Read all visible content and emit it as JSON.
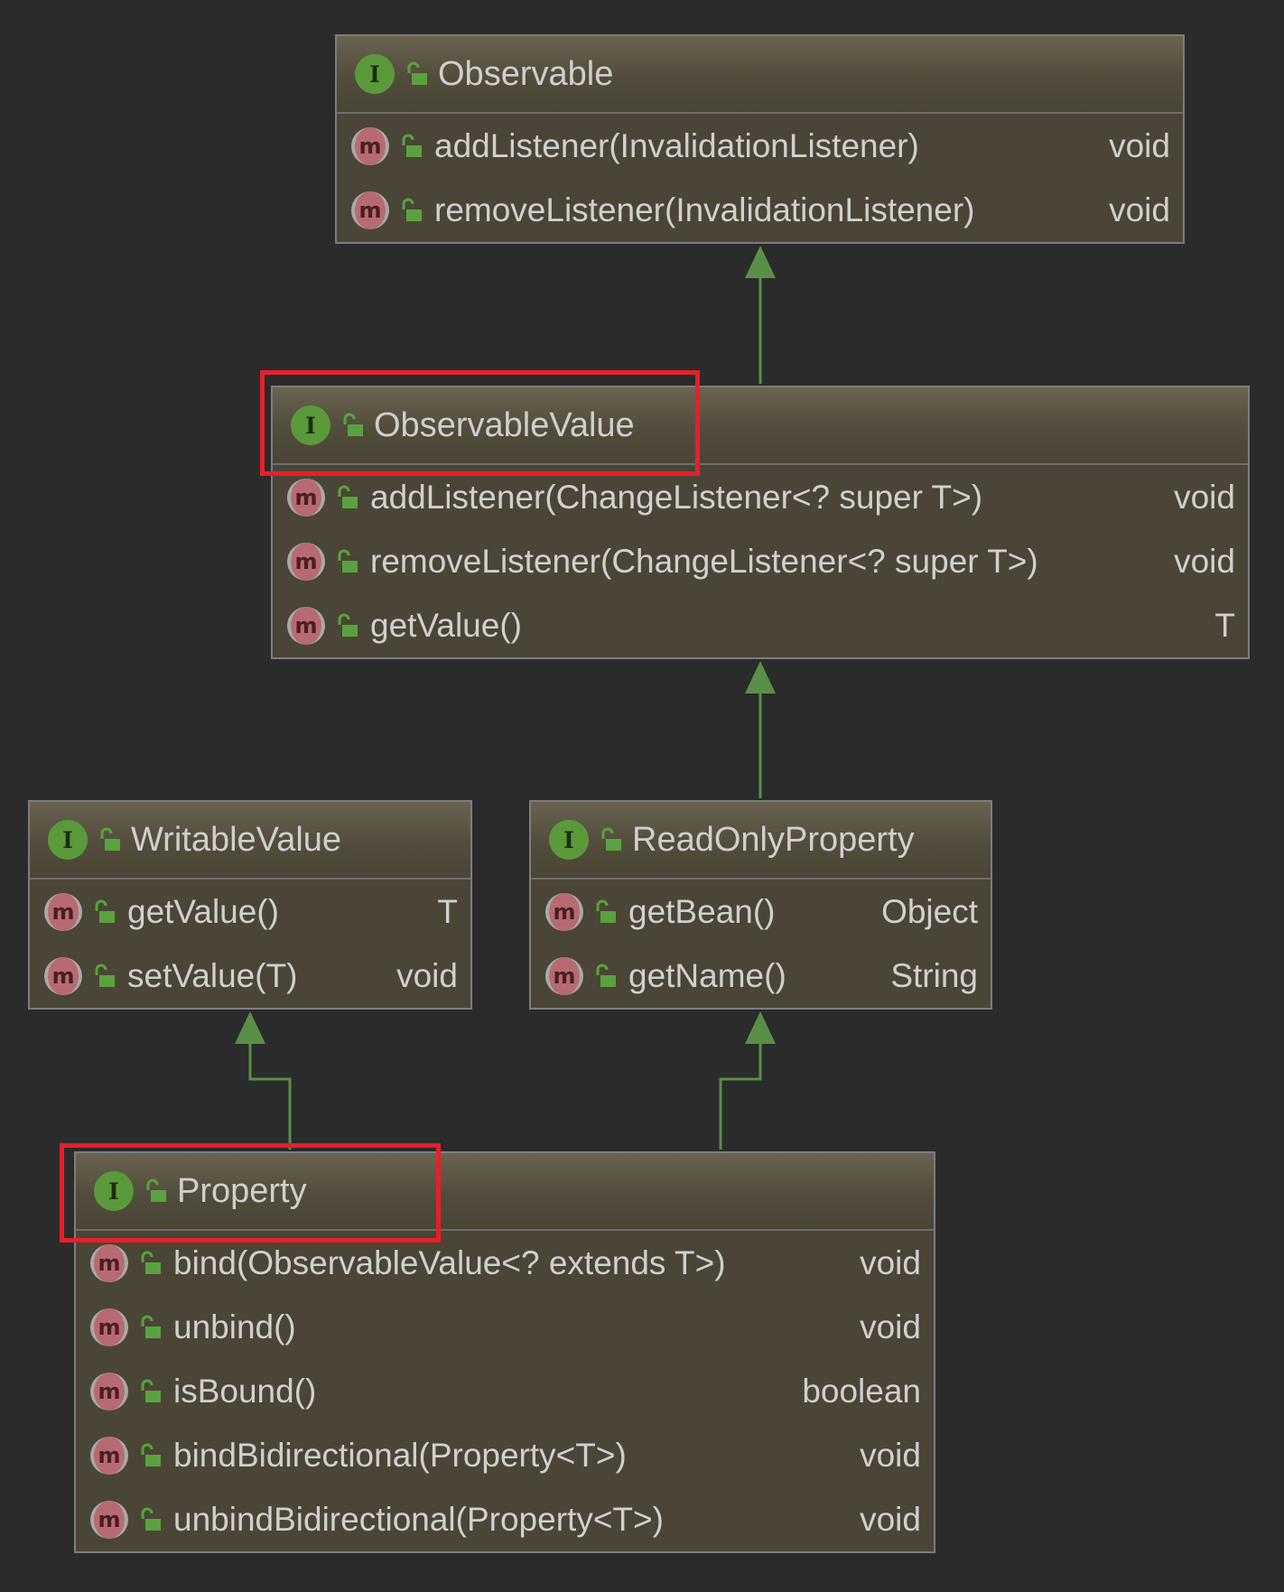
{
  "diagram": {
    "type": "uml-class-diagram",
    "colors": {
      "background": "#2b2b2b",
      "box_fill": "#4a4536",
      "arrow": "#5a8f48",
      "highlight": "#e5202a",
      "interface_icon": "#5a9a3a",
      "method_icon": "#b86a72"
    },
    "icons": {
      "interface": "interface-icon",
      "method": "method-icon",
      "visibility": "public-visibility-icon"
    },
    "interface_glyph": "I",
    "method_glyph": "m",
    "classes": {
      "observable": {
        "name": "Observable",
        "methods": [
          {
            "signature": "addListener(InvalidationListener)",
            "return_type": "void"
          },
          {
            "signature": "removeListener(InvalidationListener)",
            "return_type": "void"
          }
        ]
      },
      "observable_value": {
        "name": "ObservableValue",
        "highlighted": true,
        "methods": [
          {
            "signature": "addListener(ChangeListener<? super T>)",
            "return_type": "void"
          },
          {
            "signature": "removeListener(ChangeListener<? super T>)",
            "return_type": "void"
          },
          {
            "signature": "getValue()",
            "return_type": "T"
          }
        ]
      },
      "writable_value": {
        "name": "WritableValue",
        "methods": [
          {
            "signature": "getValue()",
            "return_type": "T"
          },
          {
            "signature": "setValue(T)",
            "return_type": "void"
          }
        ]
      },
      "read_only_property": {
        "name": "ReadOnlyProperty",
        "methods": [
          {
            "signature": "getBean()",
            "return_type": "Object"
          },
          {
            "signature": "getName()",
            "return_type": "String"
          }
        ]
      },
      "property": {
        "name": "Property",
        "highlighted": true,
        "methods": [
          {
            "signature": "bind(ObservableValue<? extends T>)",
            "return_type": "void"
          },
          {
            "signature": "unbind()",
            "return_type": "void"
          },
          {
            "signature": "isBound()",
            "return_type": "boolean"
          },
          {
            "signature": "bindBidirectional(Property<T>)",
            "return_type": "void"
          },
          {
            "signature": "unbindBidirectional(Property<T>)",
            "return_type": "void"
          }
        ]
      }
    },
    "inheritance": [
      {
        "from": "ObservableValue",
        "to": "Observable"
      },
      {
        "from": "ReadOnlyProperty",
        "to": "ObservableValue"
      },
      {
        "from": "Property",
        "to": "WritableValue"
      },
      {
        "from": "Property",
        "to": "ReadOnlyProperty"
      }
    ]
  }
}
